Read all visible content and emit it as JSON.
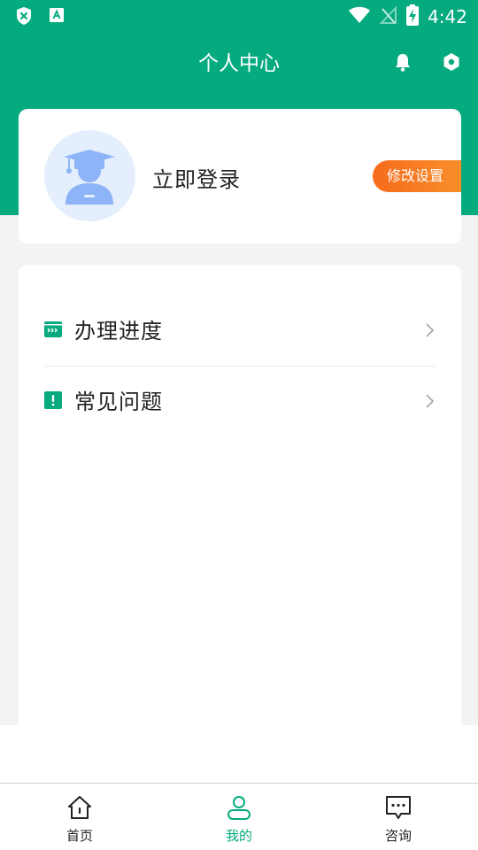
{
  "status_bar": {
    "time": "4:42",
    "icons": [
      "shield-x-icon",
      "text-a-icon",
      "wifi-icon",
      "no-signal-icon",
      "battery-charging-icon"
    ]
  },
  "header": {
    "title": "个人中心",
    "bell_icon": "bell-icon",
    "settings_icon": "hexagon-settings-icon"
  },
  "profile": {
    "avatar_icon": "graduate-avatar-icon",
    "login_label": "立即登录",
    "edit_button_label": "修改设置"
  },
  "menu": {
    "items": [
      {
        "icon": "progress-icon",
        "label": "办理进度"
      },
      {
        "icon": "exclamation-icon",
        "label": "常见问题"
      }
    ]
  },
  "bottom_nav": {
    "items": [
      {
        "icon": "home-icon",
        "label": "首页"
      },
      {
        "icon": "user-icon",
        "label": "我的",
        "active": true
      },
      {
        "icon": "chat-icon",
        "label": "咨询"
      }
    ]
  },
  "colors": {
    "brand_green": "#05ab7e",
    "accent_orange": "#f66b1c",
    "avatar_bg": "#e4eefc"
  }
}
